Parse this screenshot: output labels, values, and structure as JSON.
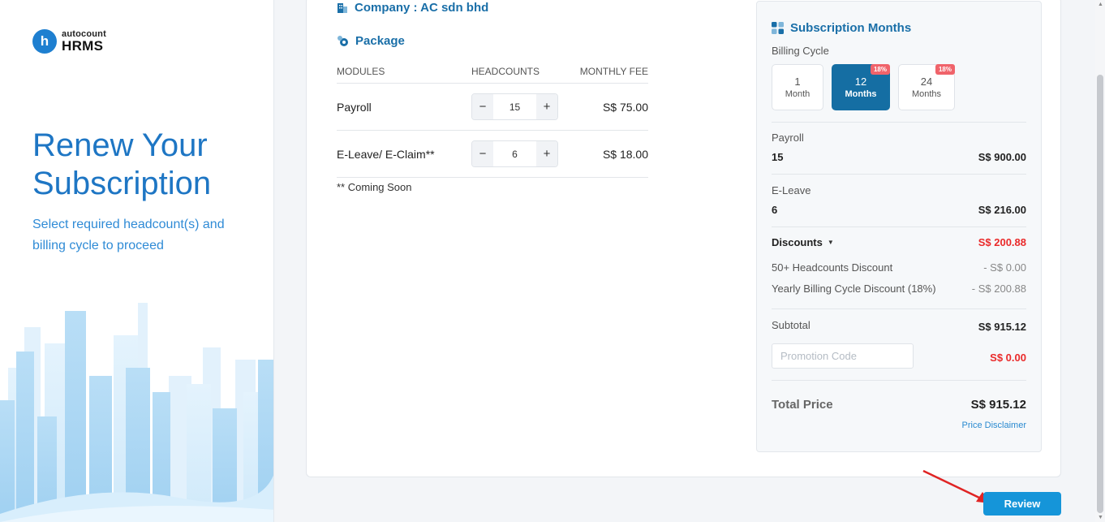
{
  "brand": {
    "top": "autocount",
    "bottom": "HRMS",
    "mark": "h"
  },
  "hero": {
    "title": "Renew Your Subscription",
    "subtitle": "Select required headcount(s) and billing cycle to proceed"
  },
  "company": {
    "label": "Company : AC sdn bhd"
  },
  "package": {
    "label": "Package",
    "headers": [
      "MODULES",
      "HEADCOUNTS",
      "MONTHLY FEE"
    ],
    "rows": [
      {
        "module": "Payroll",
        "headcount": "15",
        "fee": "S$ 75.00"
      },
      {
        "module": "E-Leave/ E-Claim**",
        "headcount": "6",
        "fee": "S$ 18.00"
      }
    ],
    "note": "** Coming Soon"
  },
  "summary": {
    "title": "Subscription Months",
    "billing_label": "Billing Cycle",
    "cycles": [
      {
        "num": "1",
        "unit": "Month",
        "tag": ""
      },
      {
        "num": "12",
        "unit": "Months",
        "tag": "18%"
      },
      {
        "num": "24",
        "unit": "Months",
        "tag": "18%"
      }
    ],
    "selected_cycle": "12",
    "payroll_label": "Payroll",
    "payroll_count": "15",
    "payroll_amount": "S$ 900.00",
    "eleave_label": "E-Leave",
    "eleave_count": "6",
    "eleave_amount": "S$ 216.00",
    "discounts_label": "Discounts",
    "discounts_amount": "S$ 200.88",
    "discount_items": [
      {
        "label": "50+ Headcounts Discount",
        "amount": "- S$ 0.00"
      },
      {
        "label": "Yearly Billing Cycle Discount (18%)",
        "amount": "- S$ 200.88"
      }
    ],
    "subtotal_label": "Subtotal",
    "subtotal_amount": "S$ 915.12",
    "promo_placeholder": "Promotion Code",
    "promo_amount": "S$ 0.00",
    "total_label": "Total Price",
    "total_amount": "S$ 915.12",
    "disclaimer": "Price Disclaimer"
  },
  "actions": {
    "review": "Review"
  },
  "colors": {
    "primary": "#1a6fa8",
    "accent": "#1595d9",
    "danger": "#ea2a2a",
    "tag": "#f0636a"
  }
}
